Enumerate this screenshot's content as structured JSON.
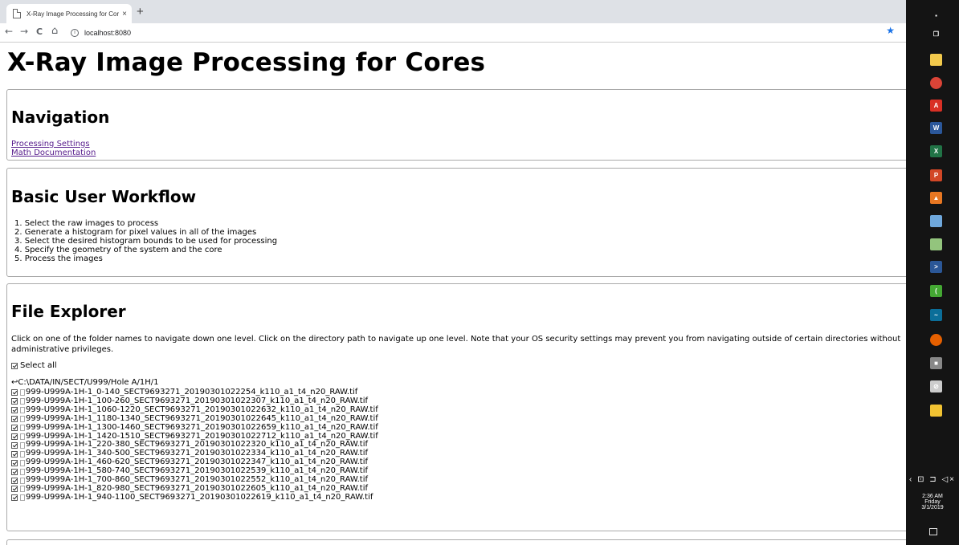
{
  "browser": {
    "tab_title": "X-Ray Image Processing for Cores",
    "tab_close": "×",
    "new_tab": "+",
    "back": "←",
    "forward": "→",
    "reload": "C",
    "home": "⌂",
    "info": "i",
    "url": "localhost:8080",
    "star": "★"
  },
  "page": {
    "title": "X-Ray Image Processing for Cores",
    "navigation": {
      "heading": "Navigation",
      "links": [
        "Processing Settings",
        "Math Documentation"
      ]
    },
    "workflow": {
      "heading": "Basic User Workflow",
      "steps": [
        "1. Select the raw images to process",
        "2. Generate a histogram for pixel values in all of the images",
        "3. Select the desired histogram bounds to be used for processing",
        "4. Specify the geometry of the system and the core",
        "5. Process the images"
      ]
    },
    "file_explorer": {
      "heading": "File Explorer",
      "description": "Click on one of the folder names to navigate down one level. Click on the directory path to navigate up one level. Note that your OS security settings may prevent you from navigating outside of certain directories without administrative privileges.",
      "select_all": "Select all",
      "directory_path": "↩C:\\DATA/IN/SECT/U999/Hole A/1H/1",
      "files": [
        "999-U999A-1H-1_0-140_SECT9693271_20190301022254_k110_a1_t4_n20_RAW.tif",
        "999-U999A-1H-1_100-260_SECT9693271_20190301022307_k110_a1_t4_n20_RAW.tif",
        "999-U999A-1H-1_1060-1220_SECT9693271_20190301022632_k110_a1_t4_n20_RAW.tif",
        "999-U999A-1H-1_1180-1340_SECT9693271_20190301022645_k110_a1_t4_n20_RAW.tif",
        "999-U999A-1H-1_1300-1460_SECT9693271_20190301022659_k110_a1_t4_n20_RAW.tif",
        "999-U999A-1H-1_1420-1510_SECT9693271_20190301022712_k110_a1_t4_n20_RAW.tif",
        "999-U999A-1H-1_220-380_SECT9693271_20190301022320_k110_a1_t4_n20_RAW.tif",
        "999-U999A-1H-1_340-500_SECT9693271_20190301022334_k110_a1_t4_n20_RAW.tif",
        "999-U999A-1H-1_460-620_SECT9693271_20190301022347_k110_a1_t4_n20_RAW.tif",
        "999-U999A-1H-1_580-740_SECT9693271_20190301022539_k110_a1_t4_n20_RAW.tif",
        "999-U999A-1H-1_700-860_SECT9693271_20190301022552_k110_a1_t4_n20_RAW.tif",
        "999-U999A-1H-1_820-980_SECT9693271_20190301022605_k110_a1_t4_n20_RAW.tif",
        "999-U999A-1H-1_940-1100_SECT9693271_20190301022619_k110_a1_t4_n20_RAW.tif"
      ]
    }
  },
  "taskbar": {
    "icons": [
      {
        "name": "windows-start-icon",
        "color": "#141414",
        "glyph": "▪"
      },
      {
        "name": "task-view-icon",
        "color": "#141414",
        "glyph": "❐"
      },
      {
        "name": "file-explorer-icon",
        "color": "#f2c94c",
        "glyph": ""
      },
      {
        "name": "chrome-icon",
        "color": "#db4437",
        "glyph": ""
      },
      {
        "name": "acrobat-icon",
        "color": "#d93025",
        "glyph": "A"
      },
      {
        "name": "word-icon",
        "color": "#2b579a",
        "glyph": "W"
      },
      {
        "name": "excel-icon",
        "color": "#217346",
        "glyph": "X"
      },
      {
        "name": "powerpoint-icon",
        "color": "#d24726",
        "glyph": "P"
      },
      {
        "name": "matlab-icon",
        "color": "#e87722",
        "glyph": "▲"
      },
      {
        "name": "paint-icon",
        "color": "#6fa8dc",
        "glyph": ""
      },
      {
        "name": "notepad-icon",
        "color": "#93c47d",
        "glyph": ""
      },
      {
        "name": "powershell-icon",
        "color": "#2b5797",
        "glyph": ">"
      },
      {
        "name": "anaconda-icon",
        "color": "#44a833",
        "glyph": "("
      },
      {
        "name": "network-icon",
        "color": "#0b6e99",
        "glyph": "~"
      },
      {
        "name": "firefox-icon",
        "color": "#e66000",
        "glyph": ""
      },
      {
        "name": "app-window-icon",
        "color": "#888888",
        "glyph": "■"
      },
      {
        "name": "clock-app-icon",
        "color": "#cccccc",
        "glyph": "⊘"
      },
      {
        "name": "image-viewer-icon",
        "color": "#f1c232",
        "glyph": ""
      }
    ],
    "tray_icons": "‹ ⊡ ⊐ ◁×",
    "time": "2:36 AM",
    "day": "Friday",
    "date": "3/1/2019"
  }
}
